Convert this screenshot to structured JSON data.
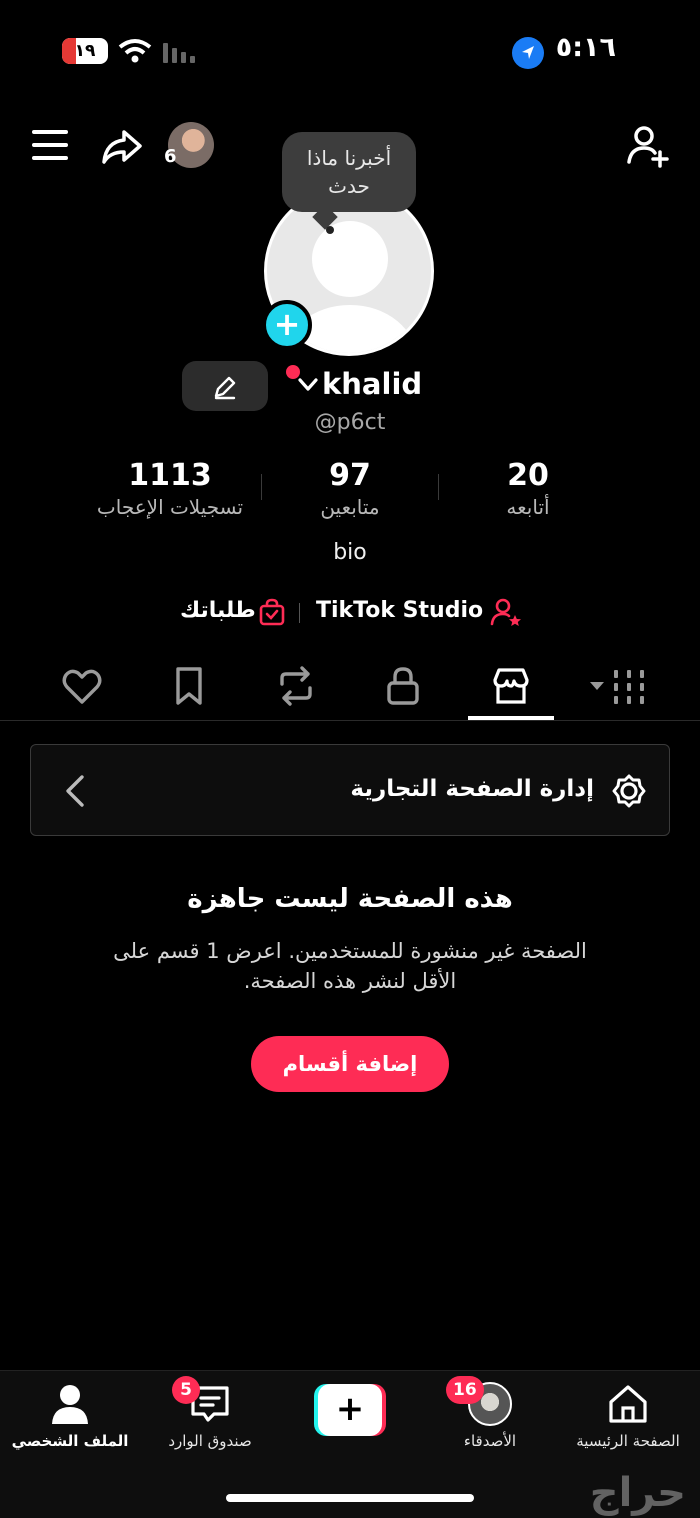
{
  "status_bar": {
    "time": "٥:١٦",
    "battery": "١٩"
  },
  "header": {
    "mini_avatar_count": "6"
  },
  "profile": {
    "tooltip_lines": [
      "أخبرنا ماذا",
      "حدث"
    ],
    "username": "khalid",
    "handle": "@p6ct",
    "bio": "bio"
  },
  "stats": [
    {
      "value": "20",
      "label": "أتابعه"
    },
    {
      "value": "97",
      "label": "متابعين"
    },
    {
      "value": "1113",
      "label": "تسجيلات الإعجاب"
    }
  ],
  "links": {
    "studio": "TikTok Studio",
    "orders": "طلباتك"
  },
  "tabs": [
    "grid-icon",
    "shop-icon",
    "lock-icon",
    "repost-icon",
    "bookmark-icon",
    "heart-icon"
  ],
  "business": {
    "manage_label": "إدارة الصفحة التجارية",
    "empty_title": "هذه الصفحة ليست جاهزة",
    "empty_desc_line1": "الصفحة غير منشورة للمستخدمين. اعرض 1 قسم على",
    "empty_desc_line2": "الأقل لنشر هذه الصفحة.",
    "add_button": "إضافة أقسام"
  },
  "bottom_nav": {
    "home": "الصفحة الرئيسية",
    "friends": "الأصدقاء",
    "friends_badge": "16",
    "inbox": "صندوق الوارد",
    "inbox_badge": "5",
    "profile": "الملف الشخصي"
  },
  "watermark": "حراج",
  "colors": {
    "accent": "#fe2c55",
    "cyan": "#20d5ec",
    "background": "#000000"
  }
}
